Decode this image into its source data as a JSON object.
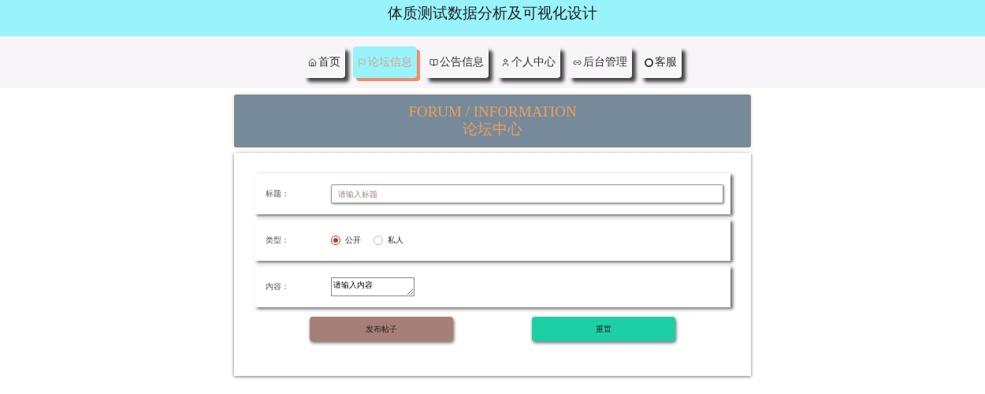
{
  "header": {
    "title": "体质测试数据分析及可视化设计"
  },
  "nav": [
    {
      "label": "首页",
      "selected": false
    },
    {
      "label": "论坛信息",
      "selected": true
    },
    {
      "label": "公告信息",
      "selected": false
    },
    {
      "label": "个人中心",
      "selected": false
    },
    {
      "label": "后台管理",
      "selected": false
    },
    {
      "label": "客服",
      "selected": false
    }
  ],
  "banner": {
    "title": "FORUM / INFORMATION",
    "subtitle": "论坛中心"
  },
  "form": {
    "fields": [
      {
        "kind": "input",
        "label": "标题：",
        "placeholder": "请输入标题"
      },
      {
        "kind": "radio",
        "label": "类型：",
        "options": [
          {
            "label": "公开",
            "selected": true
          },
          {
            "label": "私人",
            "selected": false
          }
        ]
      },
      {
        "kind": "textarea",
        "label": "内容：",
        "value": "请输入内容"
      }
    ],
    "buttons": [
      {
        "label": "发布帖子",
        "color": "#a67f76"
      },
      {
        "label": "重置",
        "color": "#1ccfa5"
      }
    ]
  }
}
